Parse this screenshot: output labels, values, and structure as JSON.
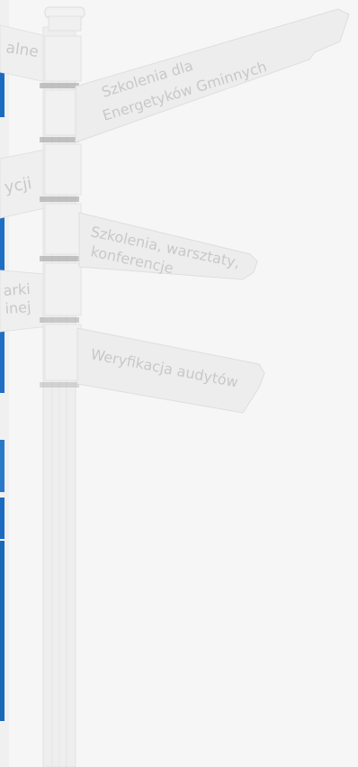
{
  "signs": {
    "left_partial": {
      "line_1": "alne",
      "line_2": "ycji",
      "line_3a": "arki",
      "line_3b": "inej"
    },
    "sign_1": {
      "line_1": "Szkolenia dla",
      "line_2": "Energetyków Gminnych"
    },
    "sign_2": {
      "line_1": "Szkolenia, warsztaty,",
      "line_2": "konferencje"
    },
    "sign_3": {
      "line_1": "Weryfikacja audytów"
    }
  },
  "colors": {
    "background": "#f6f6f6",
    "left_strip_blue": "#1a6bc0",
    "signpost": "#ececec",
    "text": "#c8c8c8"
  }
}
